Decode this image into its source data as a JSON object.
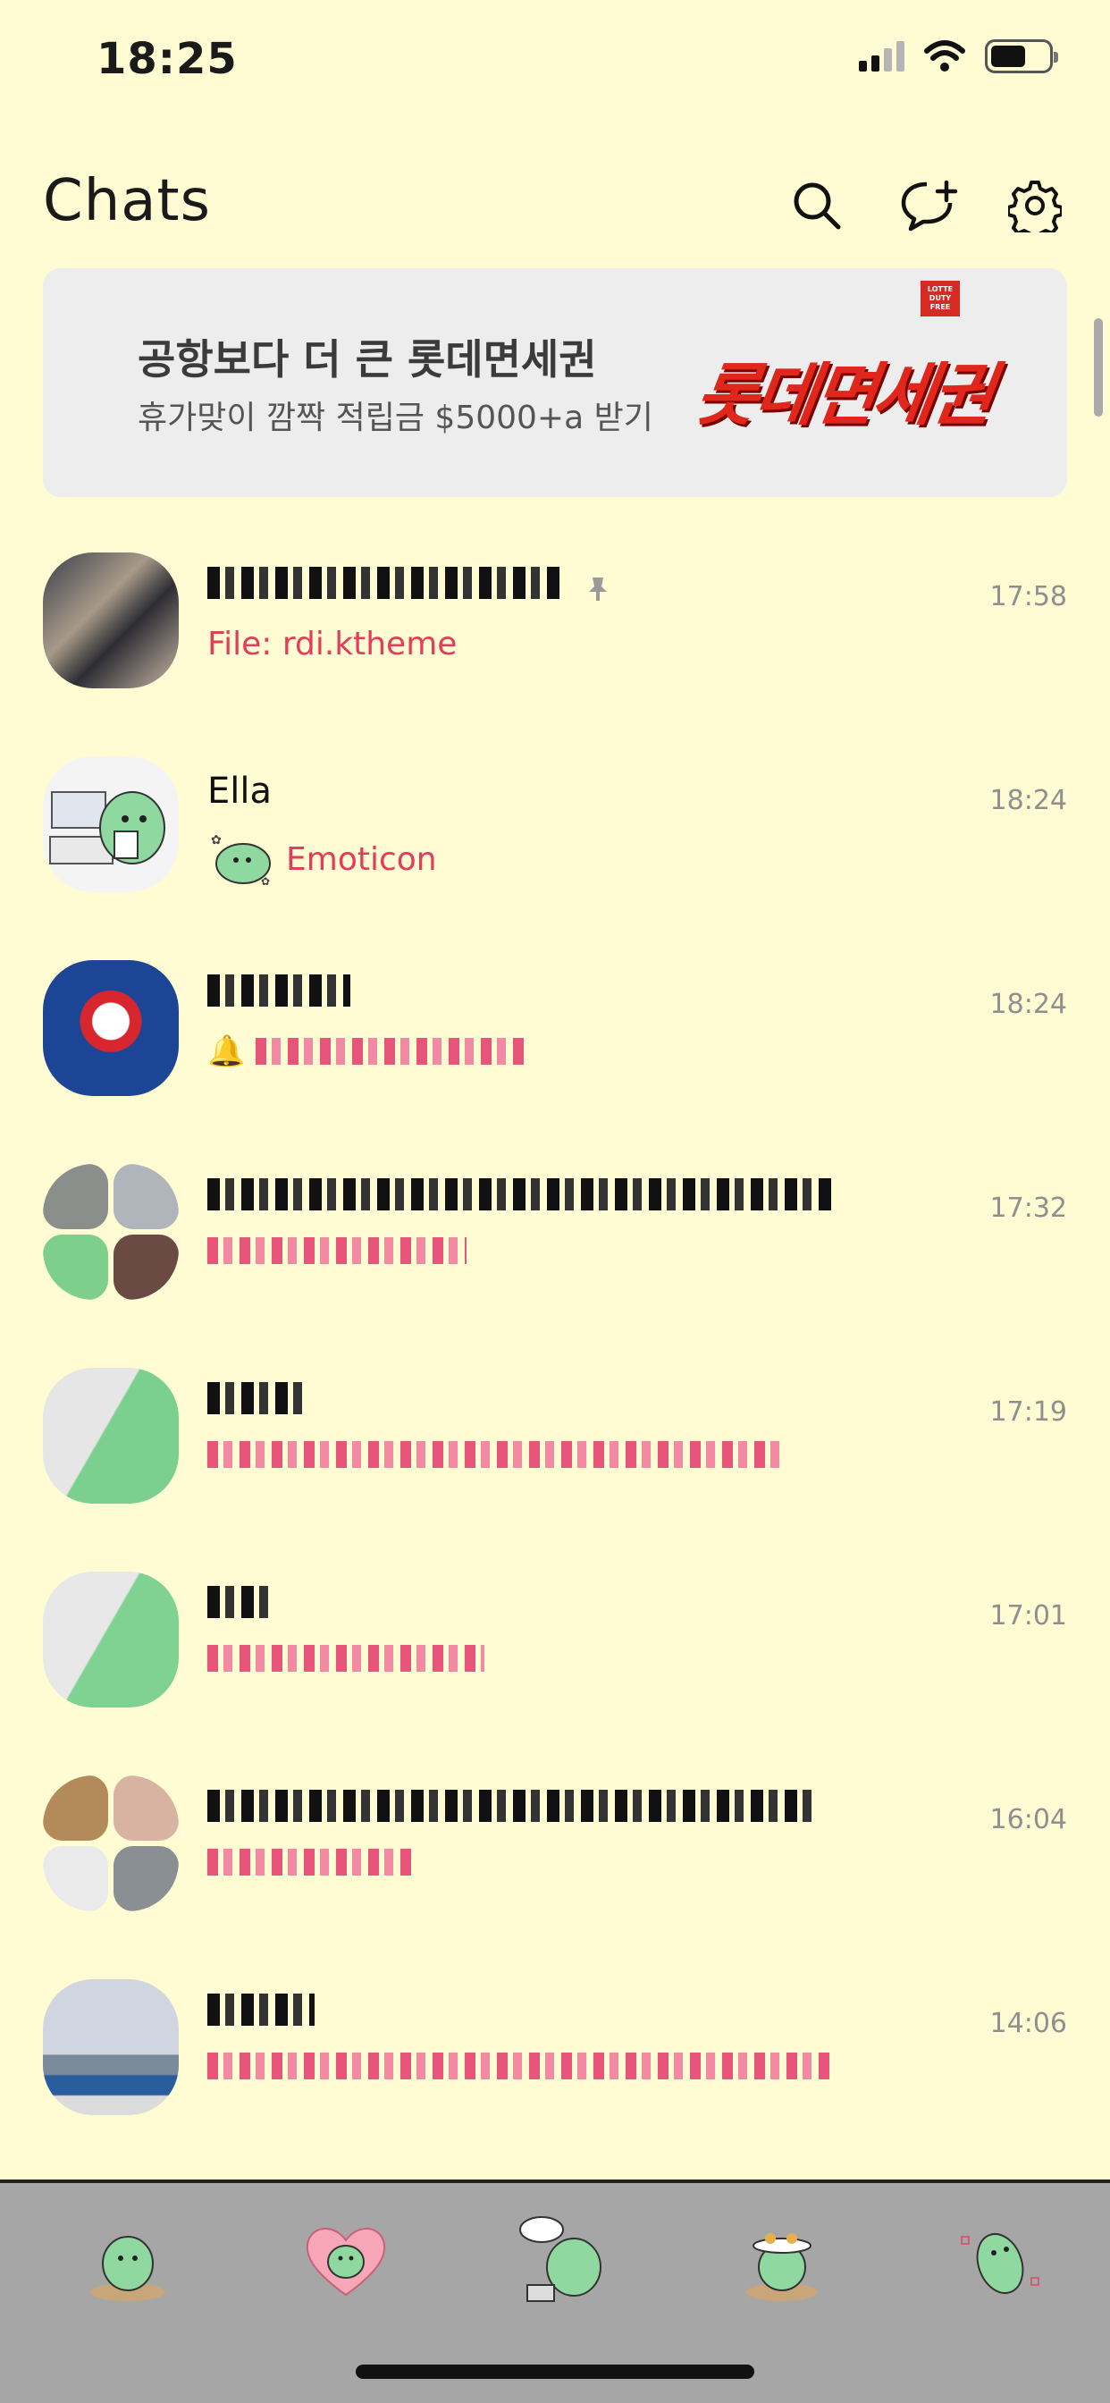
{
  "status_bar": {
    "time": "18:25"
  },
  "header": {
    "title": "Chats"
  },
  "ad": {
    "headline": "공항보다 더 큰 롯데면세권",
    "subline": "휴가맞이 깜짝 적립금 $5000+a 받기",
    "badge_line1": "LOTTE",
    "badge_line2": "DUTY",
    "badge_line3": "FREE",
    "logo_text": "롯데면세권"
  },
  "chats": [
    {
      "name": "",
      "preview": "File: rdi.ktheme",
      "time": "17:58",
      "pinned": true,
      "redacted_name": true
    },
    {
      "name": "Ella",
      "preview": "Emoticon",
      "time": "18:24"
    },
    {
      "name": "",
      "preview": "",
      "time": "18:24",
      "redacted_name": true,
      "redacted_preview": true
    },
    {
      "name": "",
      "preview": "",
      "time": "17:32",
      "redacted_name": true,
      "redacted_preview": true
    },
    {
      "name": "",
      "preview": "",
      "time": "17:19",
      "redacted_name": true,
      "redacted_preview": true
    },
    {
      "name": "",
      "preview": "",
      "time": "17:01",
      "redacted_name": true,
      "redacted_preview": true
    },
    {
      "name": "",
      "preview": "",
      "time": "16:04",
      "redacted_name": true,
      "redacted_preview": true
    },
    {
      "name": "",
      "preview": "",
      "time": "14:06",
      "redacted_name": true,
      "redacted_preview": true
    }
  ],
  "tabs": [
    {
      "icon": "friends-tab-icon"
    },
    {
      "icon": "chats-tab-icon"
    },
    {
      "icon": "view-tab-icon"
    },
    {
      "icon": "shopping-tab-icon"
    },
    {
      "icon": "more-tab-icon"
    }
  ],
  "colors": {
    "background": "#fffbd3",
    "preview_text": "#e23d5a",
    "tab_bar": "#a6a6a6",
    "ad_brand": "#e1261b"
  }
}
